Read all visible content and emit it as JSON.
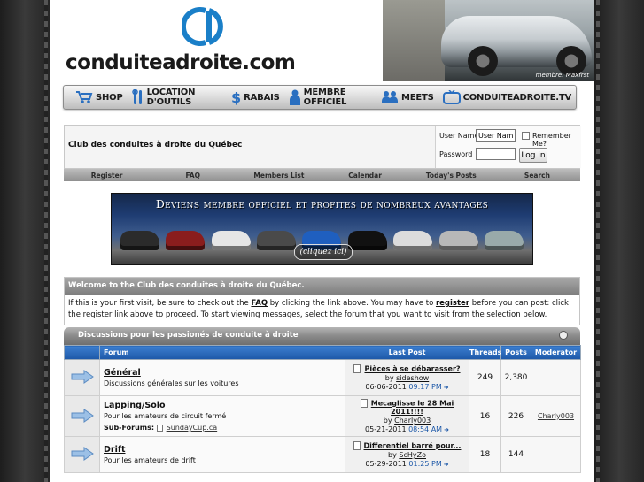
{
  "header": {
    "logo_text": "conduiteadroite.com",
    "photo_credit": "membre: Maxfrst"
  },
  "nav": {
    "items": [
      {
        "label": "SHOP",
        "icon": "cart-icon"
      },
      {
        "label": "LOCATION D'OUTILS",
        "icon": "tools-icon"
      },
      {
        "label": "RABAIS",
        "icon": "dollar-icon"
      },
      {
        "label": "MEMBRE OFFICIEL",
        "icon": "member-icon"
      },
      {
        "label": "MEETS",
        "icon": "group-icon"
      },
      {
        "label": "CONDUITEADROITE.TV",
        "icon": "tv-icon"
      }
    ]
  },
  "club": {
    "title": "Club des conduites à droite du Québec"
  },
  "login": {
    "username_label": "User Name",
    "username_value": "User Name",
    "remember_label": "Remember Me?",
    "password_label": "Password",
    "password_value": "",
    "button_label": "Log in"
  },
  "linkbar": {
    "items": [
      "Register",
      "FAQ",
      "Members List",
      "Calendar",
      "Today's Posts",
      "Search"
    ]
  },
  "banner": {
    "headline": "Deviens membre officiel et profites de nombreux avantages",
    "cta": "(cliquez ici)"
  },
  "welcome": {
    "heading": "Welcome to the Club des conduites à droite du Québec.",
    "text_1": "If this is your first visit, be sure to check out the ",
    "faq_link": "FAQ",
    "text_2": " by clicking the link above. You may have to ",
    "register_link": "register",
    "text_3": " before you can post: click the register link above to proceed. To start viewing messages, select the forum that you want to visit from the selection below."
  },
  "category": {
    "title": "Discussions pour les passionés de conduite à droite"
  },
  "table": {
    "headers": {
      "forum": "Forum",
      "last_post": "Last Post",
      "threads": "Threads",
      "posts": "Posts",
      "moderator": "Moderator"
    },
    "rows": [
      {
        "name": "Général",
        "desc": "Discussions générales sur les voitures",
        "sub_label": "",
        "sub_forum": "",
        "lp_title": "Pièces à se débarasser?",
        "lp_by_prefix": "by ",
        "lp_user": "sideshow",
        "lp_date": "06-06-2011",
        "lp_time": "09:17 PM",
        "threads": "249",
        "posts": "2,380",
        "moderator": ""
      },
      {
        "name": "Lapping/Solo",
        "desc": "Pour les amateurs de circuit fermé",
        "sub_label": "Sub-Forums",
        "sub_forum": "SundayCup.ca",
        "lp_title": "Mecaglisse le 28 Mai 2011!!!!",
        "lp_by_prefix": "by ",
        "lp_user": "Charly003",
        "lp_date": "05-21-2011",
        "lp_time": "08:54 AM",
        "threads": "16",
        "posts": "226",
        "moderator": "Charly003"
      },
      {
        "name": "Drift",
        "desc": "Pour les amateurs de drift",
        "sub_label": "",
        "sub_forum": "",
        "lp_title": "Differentiel barré pour...",
        "lp_by_prefix": "by ",
        "lp_user": "ScHyZo",
        "lp_date": "05-29-2011",
        "lp_time": "01:25 PM",
        "threads": "18",
        "posts": "144",
        "moderator": ""
      }
    ]
  },
  "colors": {
    "accent_blue": "#1d58a8",
    "logo_blue": "#1a7fc8",
    "header_gray": "#8a8a8a"
  }
}
